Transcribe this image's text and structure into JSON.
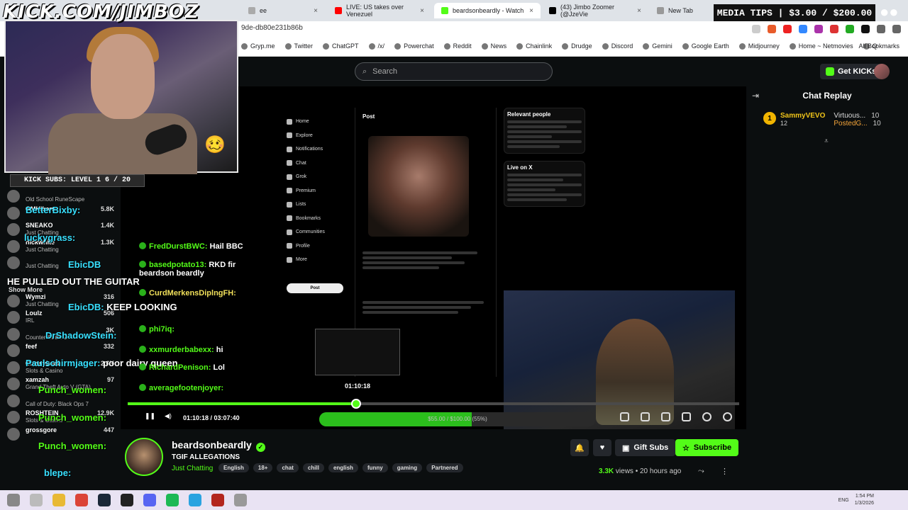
{
  "browser": {
    "tabs": [
      {
        "label": "ee",
        "color": "#aaaaaa"
      },
      {
        "label": "LIVE: US takes over Venezuel",
        "color": "#ff0000"
      },
      {
        "label": "beardsonbeardly - Watch",
        "color": "#53fc18"
      },
      {
        "label": "(43) Jimbo Zoomer (@JzeVie",
        "color": "#000000"
      },
      {
        "label": "New Tab",
        "color": "#999999"
      }
    ],
    "url": "9de-db80e231b86b",
    "bookmarks": [
      "Gryp.me",
      "Twitter",
      "ChatGPT",
      "/x/",
      "Powerchat",
      "Reddit",
      "News",
      "Chainlink",
      "Drudge",
      "Discord",
      "Gemini",
      "Google Earth",
      "Midjourney",
      "Home ~ Netmovies",
      "Q"
    ],
    "all_bookmarks": "All Bookmarks"
  },
  "overlay": {
    "logo": "KICK.COM/JIMBOZ",
    "subs_bar": "KICK SUBS: LEVEL 1 6 / 20",
    "media_tips": "MEDIA TIPS | $3.00 / $200.00",
    "big_messages": [
      {
        "user": "BetterBixby:",
        "text": ""
      },
      {
        "user": "luckygrass:",
        "text": ""
      },
      {
        "user": "EbicDB",
        "text": ""
      },
      {
        "user": "",
        "text": "HE PULLED OUT THE GUITAR"
      },
      {
        "user": "EbicDB:",
        "text": "KEEP LOOKING"
      },
      {
        "user": "DrShadowStein:",
        "text": ""
      },
      {
        "user": "Paulschirmjager:",
        "text": "poor dairy queen"
      },
      {
        "user": "Punch_women:",
        "text": ""
      },
      {
        "user": "Punch_women:",
        "text": ""
      },
      {
        "user": "Punch_women:",
        "text": ""
      },
      {
        "user": "blepe:",
        "text": ""
      }
    ],
    "chat_messages": [
      {
        "user": "FredDurstBWC:",
        "text": "Hail BBC"
      },
      {
        "user": "basedpotato13:",
        "text": "RKD fir beardson beardly"
      },
      {
        "user": "CurdMerkensDiplngFH:",
        "text": ""
      },
      {
        "user": "phi7iq:",
        "text": ""
      },
      {
        "user": "xxmurderbabexx:",
        "text": "hi"
      },
      {
        "user": "RichardPenison:",
        "text": "Lol"
      },
      {
        "user": "averagefootenjoyer:",
        "text": ""
      }
    ]
  },
  "sidebar": {
    "show_more": "Show More",
    "items": [
      {
        "name": "",
        "category": "Old School RuneScape",
        "viewers": ""
      },
      {
        "name": "GMHikaru",
        "category": "",
        "viewers": "5.8K"
      },
      {
        "name": "SNEAKO",
        "category": "Just Chatting",
        "viewers": "1.4K"
      },
      {
        "name": "nickwhite",
        "category": "Just Chatting",
        "viewers": "1.3K"
      },
      {
        "name": "",
        "category": "Just Chatting",
        "viewers": ""
      },
      {
        "name": "Wymzi",
        "category": "Just Chatting",
        "viewers": "316"
      },
      {
        "name": "Loulz",
        "category": "IRL",
        "viewers": "506"
      },
      {
        "name": "",
        "category": "Counter-Strike 2",
        "viewers": "3K"
      },
      {
        "name": "feef",
        "category": "",
        "viewers": "332"
      },
      {
        "name": "Classybeef",
        "category": "Slots & Casino",
        "viewers": "2.6K"
      },
      {
        "name": "xamzah",
        "category": "Grand Theft Auto V (GTA)",
        "viewers": "97"
      },
      {
        "name": "",
        "category": "Call of Duty: Black Ops 7",
        "viewers": ""
      },
      {
        "name": "ROSHTEIN",
        "category": "Slots & Casino",
        "viewers": "12.9K"
      },
      {
        "name": "grossgore",
        "category": "",
        "viewers": "447"
      }
    ]
  },
  "header": {
    "search_placeholder": "Search",
    "get_kicks": "Get KICKs"
  },
  "chat": {
    "title": "Chat Replay",
    "leader_name": "SammyVEVO",
    "leader_rank": "1",
    "leader_count": "12",
    "gifters": [
      {
        "name": "Virtuous...",
        "count": "10"
      },
      {
        "name": "PostedG...",
        "count": "10"
      }
    ]
  },
  "video": {
    "x_nav": [
      "Home",
      "Explore",
      "Notifications",
      "Chat",
      "Grok",
      "Premium",
      "Lists",
      "Bookmarks",
      "Communities",
      "Profile",
      "More"
    ],
    "x_post_button": "Post",
    "x_post_header": "Post",
    "x_relevant": "Relevant people",
    "x_live": "Live on X",
    "hover_time": "01:10:18",
    "current_time": "01:10:18",
    "duration": "03:07:40",
    "progress": 0.374,
    "goal_text": "$55.00 / $100.00 (55%)",
    "goal_progress": 0.55
  },
  "stream": {
    "channel": "beardsonbeardly",
    "title": "TGIF ALLEGATIONS",
    "category": "Just Chatting",
    "tags": [
      "English",
      "18+",
      "chat",
      "chill",
      "english",
      "funny",
      "gaming",
      "Partnered"
    ],
    "gift_subs": "Gift Subs",
    "subscribe": "Subscribe",
    "views": "3.3K",
    "views_label": "views",
    "ago": "20 hours ago"
  },
  "taskbar": {
    "lang": "ENG",
    "time": "1:54 PM",
    "date": "1/3/2026"
  },
  "colors": {
    "kick_green": "#53fc18",
    "bg": "#0b0e0f"
  }
}
